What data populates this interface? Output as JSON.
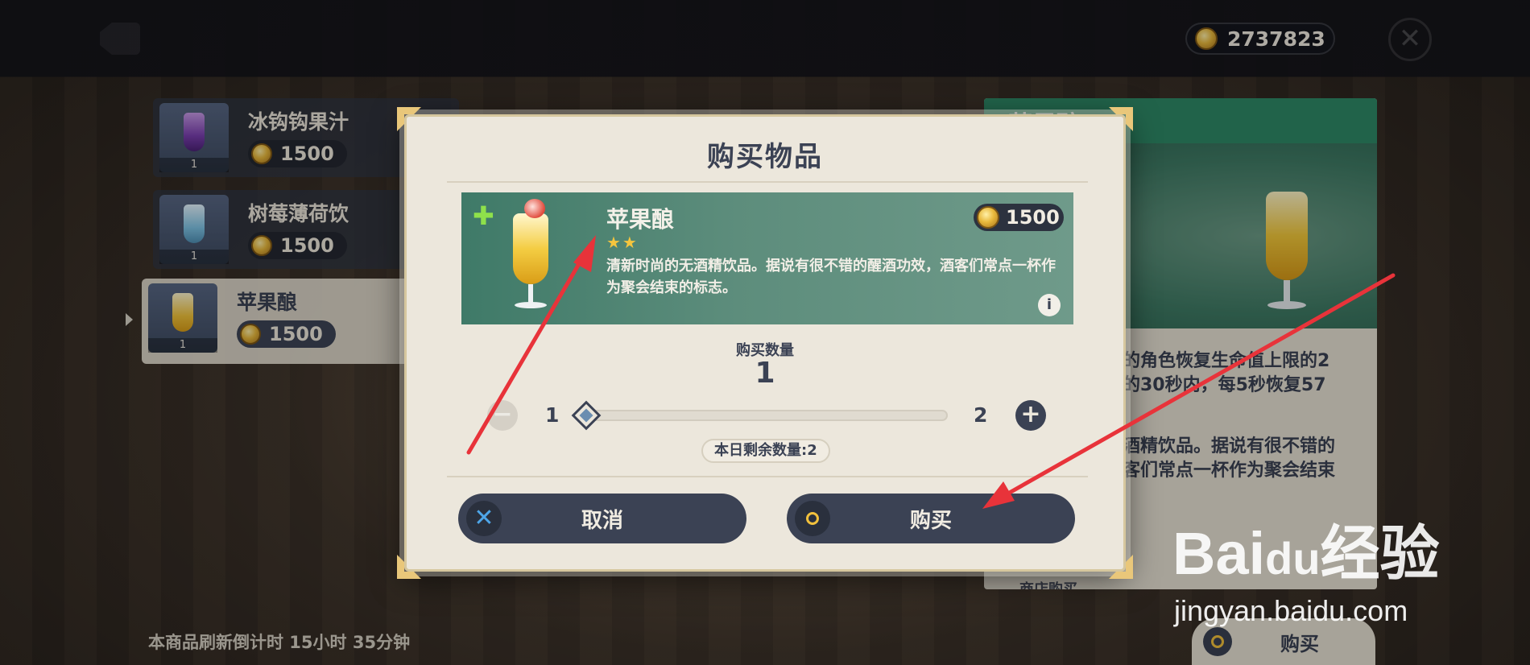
{
  "topbar": {
    "currency_amount": "2737823"
  },
  "shop_list": {
    "items": [
      {
        "name": "冰钩钩果汁",
        "price": "1500",
        "qty": "1",
        "color": "#7a3fb0"
      },
      {
        "name": "树莓薄荷饮",
        "price": "1500",
        "qty": "1",
        "color": "#7fc4e6"
      },
      {
        "name": "苹果酿",
        "price": "1500",
        "qty": "1",
        "color": "#f0c23a"
      }
    ],
    "refresh_text": "本商品刷新倒计时 15小时 35分钟"
  },
  "detail_panel": {
    "title": "苹果酿",
    "effect_line1": "的角色恢复生命值上限的2",
    "effect_line2": "的30秒内，每5秒恢复57",
    "desc_line1": "酒精饮品。据说有很不错的",
    "desc_line2": "客们常点一杯作为聚会结束",
    "footer_label": "商店购买",
    "buy_label": "购买"
  },
  "dialog": {
    "title": "购买物品",
    "item": {
      "name": "苹果酿",
      "stars": "★★",
      "price": "1500",
      "description": "清新时尚的无酒精饮品。据说有很不错的醒酒功效，酒客们常点一杯作为聚会结束的标志。"
    },
    "quantity_label": "购买数量",
    "quantity_value": "1",
    "slider_min": "1",
    "slider_max": "2",
    "remaining": "本日剩余数量:2",
    "cancel_label": "取消",
    "buy_label": "购买"
  },
  "watermark": {
    "logo": "Bai du 经验",
    "url": "jingyan.baidu.com"
  },
  "colors": {
    "accent_green": "#2f8a67",
    "button_dark": "#3b4254",
    "dialog_bg": "#ece7dc",
    "arrow_red": "#e8333a",
    "coin_gold": "#e9b93c"
  }
}
